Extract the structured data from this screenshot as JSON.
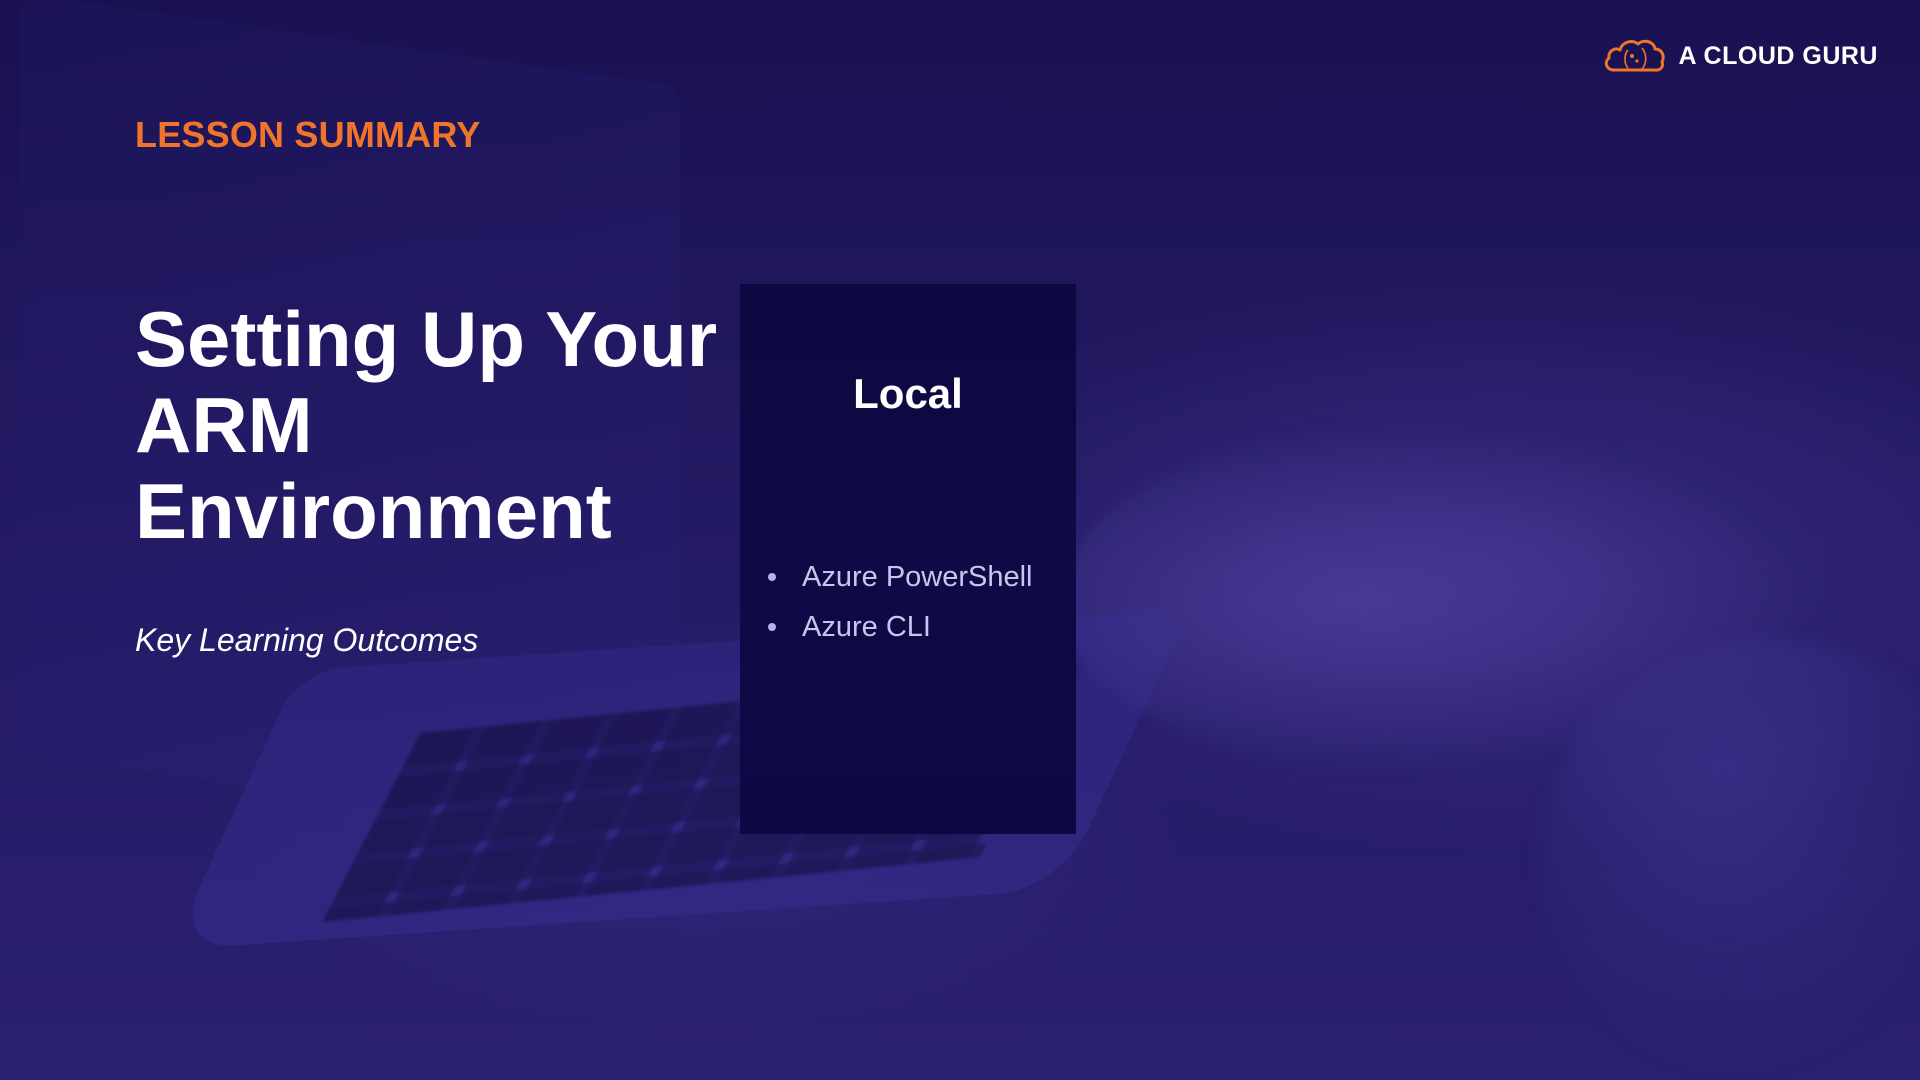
{
  "brand": {
    "name": "A CLOUD GURU",
    "logo_icon": "cloud-logo-icon",
    "logo_color": "#f0752b"
  },
  "slide": {
    "eyebrow": "LESSON SUMMARY",
    "title_lines": [
      "Setting Up Your",
      "ARM",
      "Environment"
    ],
    "subtitle": "Key Learning Outcomes"
  },
  "card": {
    "title": "Local",
    "items": [
      "Azure PowerShell",
      "Azure CLI"
    ]
  },
  "colors": {
    "accent": "#f0752b",
    "background": "#241a66",
    "card_background": "#0e0842",
    "text": "#ffffff",
    "muted_text": "#c9c5ec"
  }
}
